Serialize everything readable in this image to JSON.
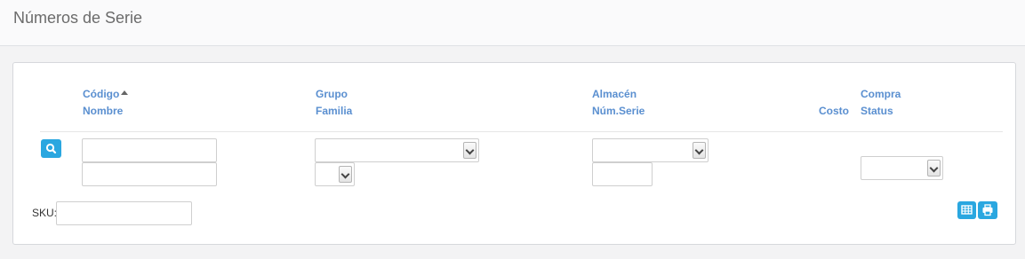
{
  "page": {
    "title": "Números de Serie"
  },
  "columns": {
    "codigo": "Código",
    "nombre": "Nombre",
    "grupo": "Grupo",
    "familia": "Familia",
    "almacen": "Almacén",
    "num_serie": "Núm.Serie",
    "costo": "Costo",
    "compra": "Compra",
    "status": "Status"
  },
  "sort": {
    "column": "Código",
    "direction": "ascending"
  },
  "filters": {
    "codigo": "",
    "nombre": "",
    "grupo": "",
    "familia": "",
    "almacen": "",
    "num_serie": "",
    "status": ""
  },
  "sku": {
    "label": "SKU:",
    "value": ""
  },
  "icons": {
    "search": "search-icon",
    "grid": "grid-icon",
    "print": "print-icon"
  },
  "colors": {
    "accent": "#2aa7e0",
    "header_text": "#5a8fd0"
  }
}
